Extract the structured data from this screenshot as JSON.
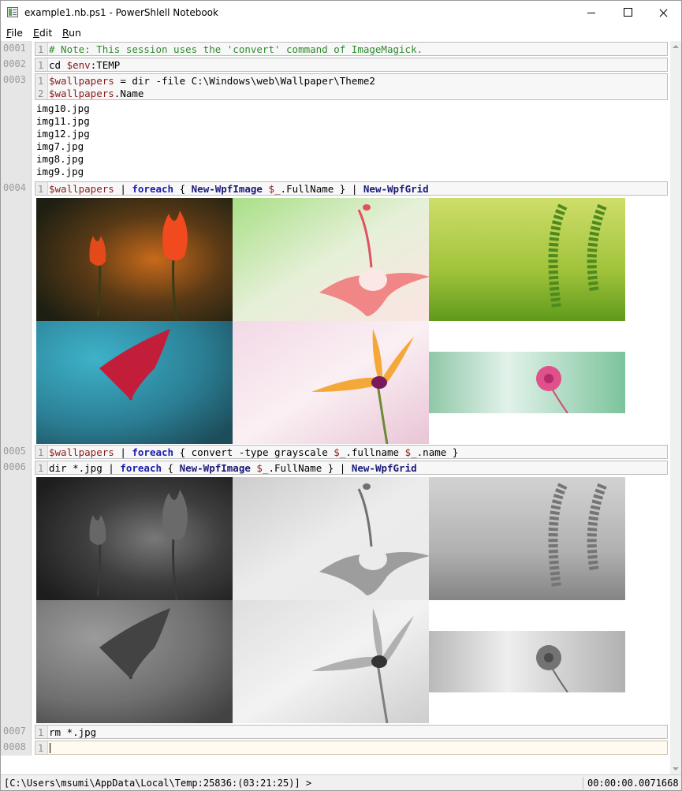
{
  "window": {
    "title": "example1.nb.ps1 - PowerShlell Notebook"
  },
  "menu": {
    "file": "File",
    "edit": "Edit",
    "run": "Run"
  },
  "cells": [
    {
      "id": "0001",
      "lines": [
        {
          "n": "1",
          "tokens": [
            {
              "t": "# Note: This session uses the 'convert' command of ImageMagick.",
              "k": "comment"
            }
          ]
        }
      ]
    },
    {
      "id": "0002",
      "lines": [
        {
          "n": "1",
          "tokens": [
            {
              "t": "cd ",
              "k": "plain"
            },
            {
              "t": "$env",
              "k": "var"
            },
            {
              "t": ":TEMP",
              "k": "plain"
            }
          ]
        }
      ]
    },
    {
      "id": "0003",
      "lines": [
        {
          "n": "1",
          "tokens": [
            {
              "t": "$wallpapers",
              "k": "var"
            },
            {
              "t": " = dir -file C:\\Windows\\web\\Wallpaper\\Theme2",
              "k": "plain"
            }
          ]
        },
        {
          "n": "2",
          "tokens": [
            {
              "t": "$wallpapers",
              "k": "var"
            },
            {
              "t": ".Name",
              "k": "plain"
            }
          ]
        }
      ],
      "output": [
        "img10.jpg",
        "img11.jpg",
        "img12.jpg",
        "img7.jpg",
        "img8.jpg",
        "img9.jpg"
      ]
    },
    {
      "id": "0004",
      "lines": [
        {
          "n": "1",
          "tokens": [
            {
              "t": "$wallpapers",
              "k": "var"
            },
            {
              "t": " | ",
              "k": "plain"
            },
            {
              "t": "foreach",
              "k": "kw"
            },
            {
              "t": " { ",
              "k": "plain"
            },
            {
              "t": "New-WpfImage",
              "k": "cmd"
            },
            {
              "t": " ",
              "k": "plain"
            },
            {
              "t": "$_",
              "k": "var"
            },
            {
              "t": ".FullName } | ",
              "k": "plain"
            },
            {
              "t": "New-WpfGrid",
              "k": "cmd"
            }
          ]
        }
      ],
      "images": [
        "red-tulips",
        "pink-flower",
        "green-leaves",
        "red-cactus-flower",
        "orange-star-flower",
        "magenta-small-flower"
      ]
    },
    {
      "id": "0005",
      "lines": [
        {
          "n": "1",
          "tokens": [
            {
              "t": "$wallpapers",
              "k": "var"
            },
            {
              "t": " | ",
              "k": "plain"
            },
            {
              "t": "foreach",
              "k": "kw"
            },
            {
              "t": " { convert -type grayscale ",
              "k": "plain"
            },
            {
              "t": "$_",
              "k": "var"
            },
            {
              "t": ".fullname ",
              "k": "plain"
            },
            {
              "t": "$_",
              "k": "var"
            },
            {
              "t": ".name }",
              "k": "plain"
            }
          ]
        }
      ]
    },
    {
      "id": "0006",
      "lines": [
        {
          "n": "1",
          "tokens": [
            {
              "t": "dir *.jpg | ",
              "k": "plain"
            },
            {
              "t": "foreach",
              "k": "kw"
            },
            {
              "t": " { ",
              "k": "plain"
            },
            {
              "t": "New-WpfImage",
              "k": "cmd"
            },
            {
              "t": " ",
              "k": "plain"
            },
            {
              "t": "$_",
              "k": "var"
            },
            {
              "t": ".FullName } | ",
              "k": "plain"
            },
            {
              "t": "New-WpfGrid",
              "k": "cmd"
            }
          ]
        }
      ],
      "images": [
        "red-tulips-grayscale",
        "pink-flower-grayscale",
        "green-leaves-grayscale",
        "red-cactus-flower-grayscale",
        "orange-star-flower-grayscale",
        "magenta-small-flower-grayscale"
      ]
    },
    {
      "id": "0007",
      "lines": [
        {
          "n": "1",
          "tokens": [
            {
              "t": "rm *.jpg",
              "k": "plain"
            }
          ]
        }
      ]
    },
    {
      "id": "0008",
      "lines": [
        {
          "n": "1",
          "tokens": []
        }
      ],
      "active": true
    }
  ],
  "status": {
    "path": "[C:\\Users\\msumi\\AppData\\Local\\Temp:25836:(03:21:25)] >",
    "elapsed": "00:00:00.0071668"
  },
  "colors": {
    "comment": "#2e8b2e",
    "variable": "#8b1a1a",
    "keyword": "#1b1bb4",
    "cmdlet": "#1a1a7a"
  }
}
